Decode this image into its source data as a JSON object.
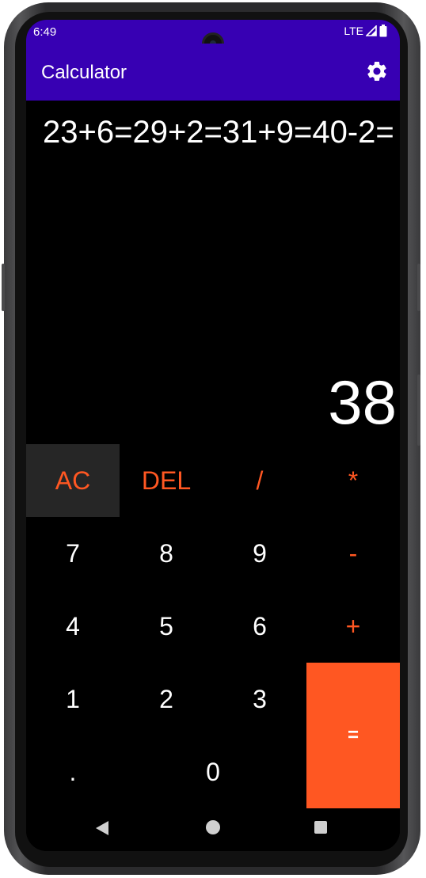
{
  "status_bar": {
    "time": "6:49",
    "network": "LTE"
  },
  "app_bar": {
    "title": "Calculator",
    "settings_icon": "gear-icon"
  },
  "display": {
    "expression": "23+6=29+2=31+9=40-2=",
    "result": "38"
  },
  "keypad": {
    "rows": [
      [
        "AC",
        "DEL",
        "/",
        "*"
      ],
      [
        "7",
        "8",
        "9",
        "-"
      ],
      [
        "4",
        "5",
        "6",
        "+"
      ],
      [
        "1",
        "2",
        "3",
        "="
      ],
      [
        ".",
        "0"
      ]
    ]
  },
  "colors": {
    "app_bar": "#3700b3",
    "accent": "#ff5722",
    "ac_background": "#262626",
    "background": "#000000"
  },
  "nav": {
    "back_icon": "back-icon",
    "home_icon": "home-icon",
    "recents_icon": "recents-icon"
  }
}
